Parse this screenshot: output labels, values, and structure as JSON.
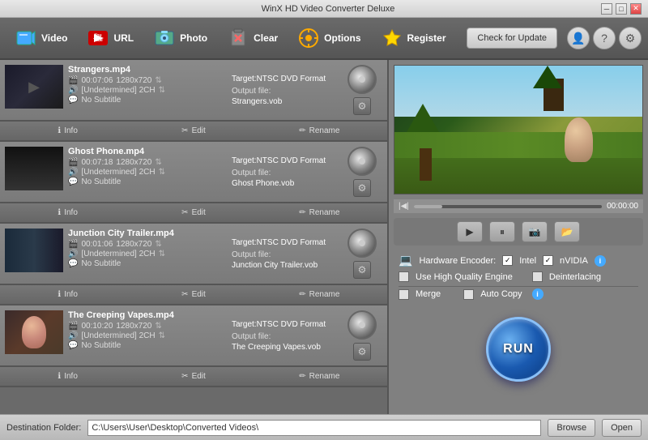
{
  "titleBar": {
    "title": "WinX HD Video Converter Deluxe",
    "minBtn": "─",
    "maxBtn": "□",
    "closeBtn": "✕"
  },
  "toolbar": {
    "videoLabel": "Video",
    "urlLabel": "URL",
    "photoLabel": "Photo",
    "clearLabel": "Clear",
    "optionsLabel": "Options",
    "registerLabel": "Register",
    "checkUpdateLabel": "Check for Update"
  },
  "files": [
    {
      "name": "Strangers.mp4",
      "duration": "00:07:06",
      "resolution": "1280x720",
      "audio": "[Undetermined] 2CH",
      "subtitle": "No Subtitle",
      "target": "Target:NTSC DVD Format",
      "output": "Strangers.vob",
      "thumbType": "dark"
    },
    {
      "name": "Ghost Phone.mp4",
      "duration": "00:07:18",
      "resolution": "1280x720",
      "audio": "[Undetermined] 2CH",
      "subtitle": "No Subtitle",
      "target": "Target:NTSC DVD Format",
      "output": "Ghost Phone.vob",
      "thumbType": "scene"
    },
    {
      "name": "Junction City Trailer.mp4",
      "duration": "00:01:06",
      "resolution": "1280x720",
      "audio": "[Undetermined] 2CH",
      "subtitle": "No Subtitle",
      "target": "Target:NTSC DVD Format",
      "output": "Junction City Trailer.vob",
      "thumbType": "dark"
    },
    {
      "name": "The Creeping Vapes.mp4",
      "duration": "00:10:20",
      "resolution": "1280x720",
      "audio": "[Undetermined] 2CH",
      "subtitle": "No Subtitle",
      "target": "Target:NTSC DVD Format",
      "output": "The Creeping Vapes.vob",
      "thumbType": "face"
    }
  ],
  "actions": {
    "info": "Info",
    "edit": "Edit",
    "rename": "Rename"
  },
  "preview": {
    "time": "00:00:00"
  },
  "controls": {
    "play": "▶",
    "pause": "⏸",
    "camera": "📷",
    "folder": "📂"
  },
  "options": {
    "hwEncoderLabel": "Hardware Encoder:",
    "intelLabel": "Intel",
    "nvidiaLabel": "nVIDIA",
    "highQualityLabel": "Use High Quality Engine",
    "deinterlacingLabel": "Deinterlacing",
    "mergeLabel": "Merge",
    "autoCopyLabel": "Auto Copy",
    "intelChecked": true,
    "nvidiaChecked": true
  },
  "runBtn": "RUN",
  "bottomBar": {
    "destLabel": "Destination Folder:",
    "destPath": "C:\\Users\\User\\Desktop\\Converted Videos\\",
    "browseLabel": "Browse",
    "openLabel": "Open"
  }
}
